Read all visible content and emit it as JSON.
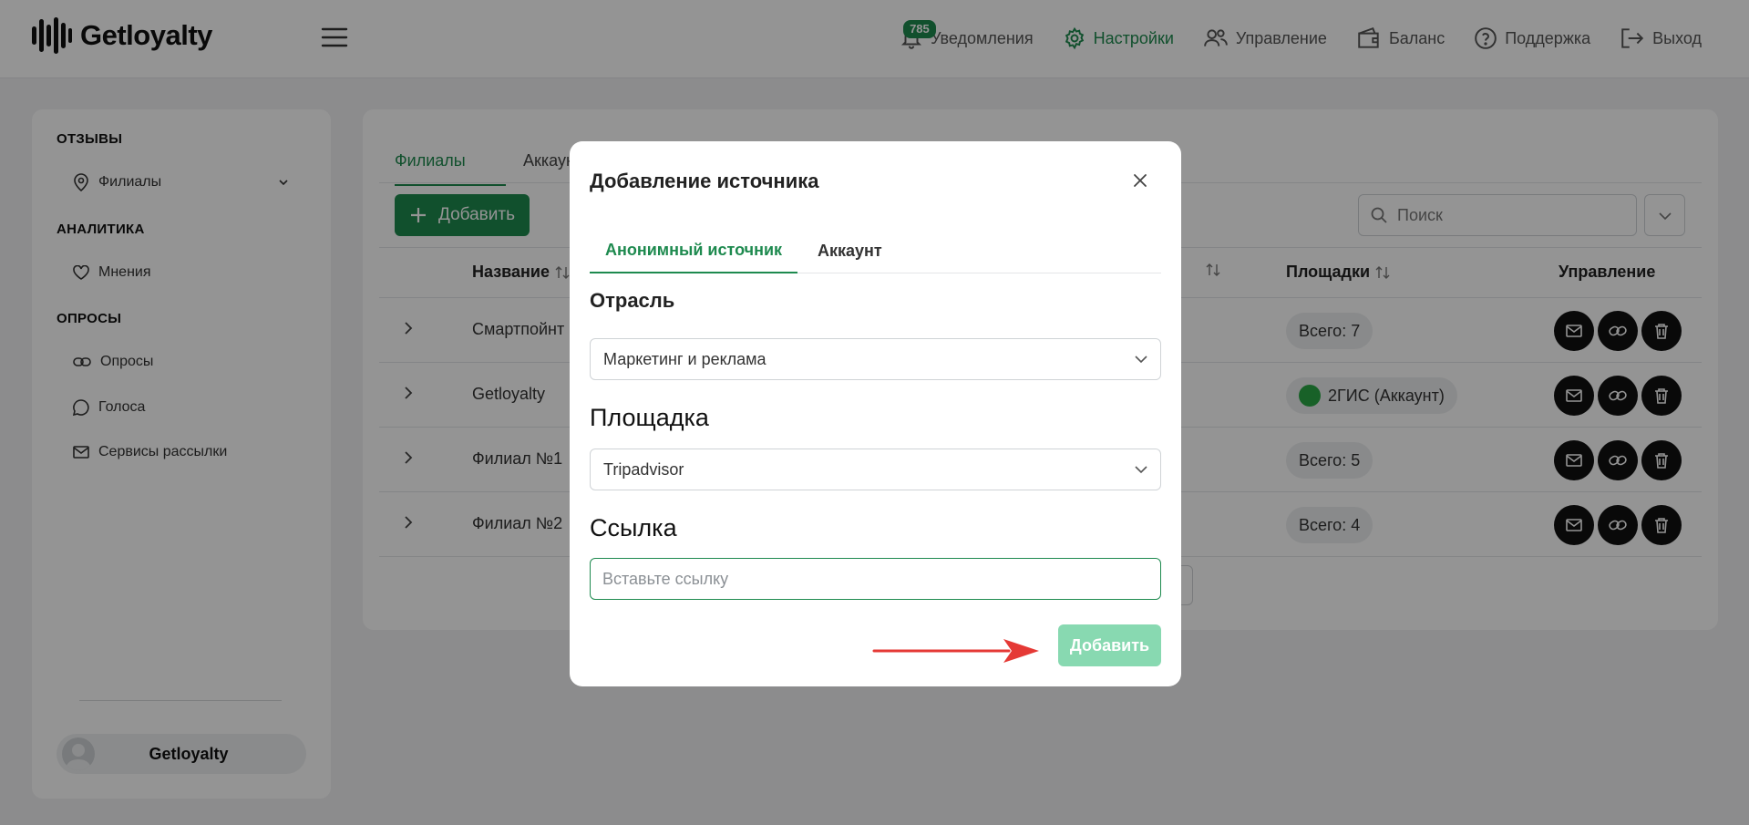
{
  "app": {
    "logo_text": "Getloyalty"
  },
  "header": {
    "nav": [
      {
        "label": "Уведомления",
        "icon": "bell-icon",
        "badge": "785"
      },
      {
        "label": "Настройки",
        "icon": "gear-icon",
        "active": true
      },
      {
        "label": "Управление",
        "icon": "users-icon"
      },
      {
        "label": "Баланс",
        "icon": "wallet-icon"
      },
      {
        "label": "Поддержка",
        "icon": "question-icon"
      },
      {
        "label": "Выход",
        "icon": "logout-icon"
      }
    ]
  },
  "sidebar": {
    "sections": [
      {
        "title": "ОТЗЫВЫ",
        "items": [
          {
            "label": "Филиалы",
            "icon": "location-pin-icon"
          }
        ]
      },
      {
        "title": "АНАЛИТИКА",
        "items": [
          {
            "label": "Мнения",
            "icon": "heart-icon"
          }
        ]
      },
      {
        "title": "ОПРОСЫ",
        "items": [
          {
            "label": "Опросы",
            "icon": "link-icon"
          },
          {
            "label": "Голоса",
            "icon": "chat-icon"
          },
          {
            "label": "Сервисы рассылки",
            "icon": "mail-icon"
          }
        ]
      }
    ],
    "user": {
      "name": "Getloyalty"
    }
  },
  "main": {
    "tabs": [
      "Филиалы",
      "Аккаунт"
    ],
    "add_label": "Добавить",
    "search_placeholder": "Поиск",
    "columns": [
      "Название",
      "Площадки",
      "Управление"
    ],
    "rows": [
      {
        "name": "Смартпойнт",
        "platform": "Всего: 7"
      },
      {
        "name": "Getloyalty",
        "platform": "2ГИС (Аккаунт)"
      },
      {
        "name": "Филиал №1",
        "platform": "Всего: 5"
      },
      {
        "name": "Филиал №2",
        "platform": "Всего: 4"
      }
    ]
  },
  "modal": {
    "title": "Добавление источника",
    "tabs": [
      "Анонимный источник",
      "Аккаунт"
    ],
    "industry_label": "Отрасль",
    "industry_value": "Маркетинг и реклама",
    "platform_label": "Площадка",
    "platform_value": "Tripadvisor",
    "link_label": "Ссылка",
    "link_placeholder": "Вставьте ссылку",
    "link_value": "",
    "submit_label": "Добавить"
  },
  "colors": {
    "accent": "#1e8a4f",
    "accent_disabled": "#88d9b1",
    "annotation_arrow": "#e53935"
  }
}
